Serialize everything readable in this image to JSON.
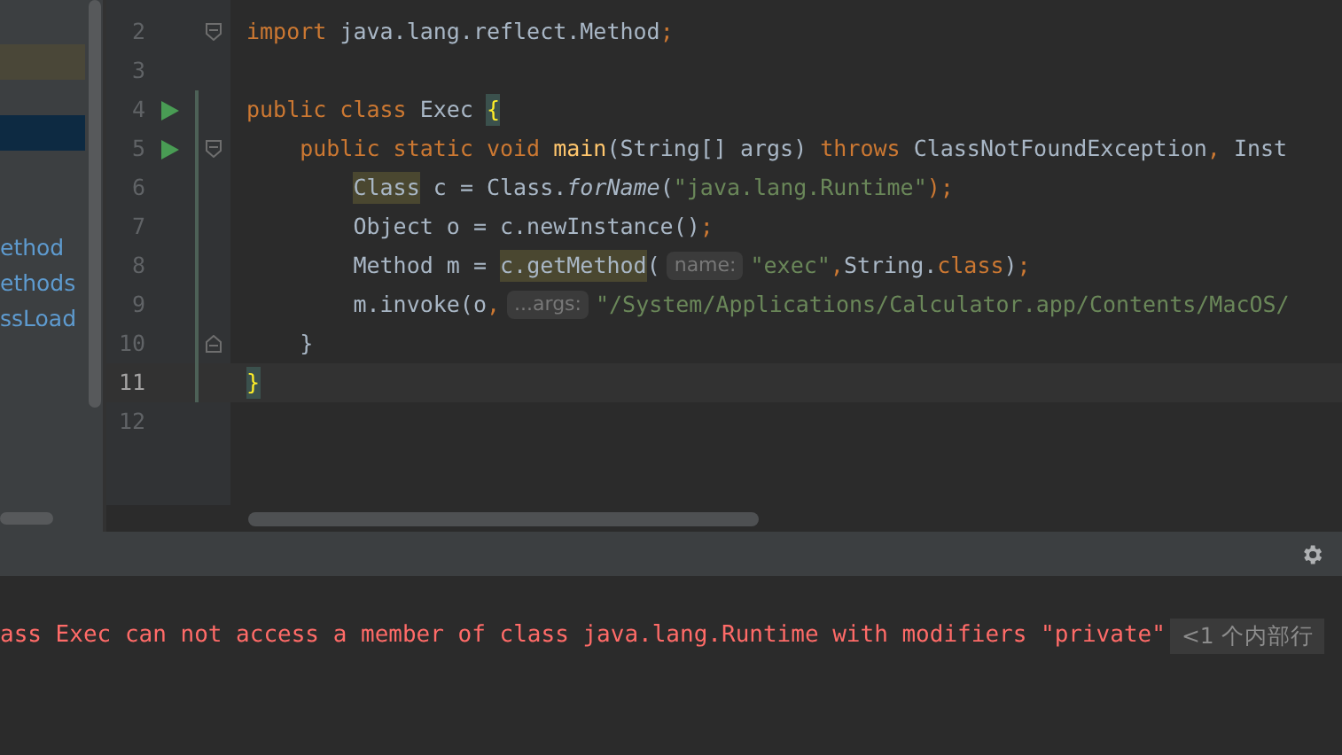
{
  "sidebar": {
    "rows": [
      {
        "kind": "highlight",
        "color": "#4a4738"
      },
      {
        "kind": "highlight",
        "color": "#0d2a42"
      }
    ],
    "items": [
      "ethod",
      "ethods",
      "ssLoad"
    ]
  },
  "editor": {
    "lines": [
      {
        "number": "2",
        "current": false,
        "run": false,
        "fold_open": true,
        "tokens": [
          {
            "text": "import",
            "kind": "kw"
          },
          {
            "text": " java.lang.reflect.Method",
            "kind": "plain"
          },
          {
            "text": ";",
            "kind": "kw"
          }
        ]
      },
      {
        "number": "3",
        "current": false,
        "run": false
      },
      {
        "number": "4",
        "current": false,
        "run": true,
        "tokens": [
          {
            "text": "public class ",
            "kind": "kw"
          },
          {
            "text": "Exec ",
            "kind": "plain"
          },
          {
            "text": "{",
            "kind": "brace"
          }
        ]
      },
      {
        "number": "5",
        "current": false,
        "run": true,
        "fold_open": true,
        "tokens": [
          {
            "text": "    public static void ",
            "kind": "kw"
          },
          {
            "text": "main",
            "kind": "fn"
          },
          {
            "text": "(String[] args) ",
            "kind": "plain"
          },
          {
            "text": "throws ",
            "kind": "kw"
          },
          {
            "text": "ClassNotFoundException",
            "kind": "plain"
          },
          {
            "text": ", ",
            "kind": "kw"
          },
          {
            "text": "Inst",
            "kind": "plain"
          }
        ]
      },
      {
        "number": "6",
        "current": false,
        "run": false,
        "tokens": [
          {
            "text": "        Class",
            "kind": "hl"
          },
          {
            "text": " c = Class.",
            "kind": "plain"
          },
          {
            "text": "forName",
            "kind": "static"
          },
          {
            "text": "(",
            "kind": "plain"
          },
          {
            "text": "\"java.lang.Runtime\"",
            "kind": "str"
          },
          {
            "text": ");",
            "kind": "kw"
          }
        ]
      },
      {
        "number": "7",
        "current": false,
        "run": false,
        "tokens": [
          {
            "text": "        Object o = c.newInstance()",
            "kind": "plain"
          },
          {
            "text": ";",
            "kind": "kw"
          }
        ]
      },
      {
        "number": "8",
        "current": false,
        "run": false,
        "tokens": [
          {
            "text": "        Method m = ",
            "kind": "plain"
          },
          {
            "text": "c.getMethod",
            "kind": "hl"
          },
          {
            "text": "(",
            "kind": "plain"
          },
          {
            "text": "name:",
            "kind": "hint"
          },
          {
            "text": "\"exec\"",
            "kind": "str"
          },
          {
            "text": ",",
            "kind": "kw"
          },
          {
            "text": "String.",
            "kind": "plain"
          },
          {
            "text": "class",
            "kind": "kw"
          },
          {
            "text": ")",
            "kind": "plain"
          },
          {
            "text": ";",
            "kind": "kw"
          }
        ]
      },
      {
        "number": "9",
        "current": false,
        "run": false,
        "tokens": [
          {
            "text": "        m.invoke(o",
            "kind": "plain"
          },
          {
            "text": ",",
            "kind": "kw"
          },
          {
            "text": "...args:",
            "kind": "hint"
          },
          {
            "text": "\"/System/Applications/Calculator.app/Contents/MacOS/",
            "kind": "str"
          }
        ]
      },
      {
        "number": "10",
        "current": false,
        "run": false,
        "fold_close": true,
        "tokens": [
          {
            "text": "    }",
            "kind": "plain"
          }
        ]
      },
      {
        "number": "11",
        "current": true,
        "run": false,
        "tokens": [
          {
            "text": "}",
            "kind": "brace"
          }
        ]
      },
      {
        "number": "12",
        "current": false,
        "run": false
      }
    ]
  },
  "console": {
    "error": "ass Exec can not access a member of class java.lang.Runtime with modifiers \"private\"",
    "folded": "<1 个内部行"
  }
}
